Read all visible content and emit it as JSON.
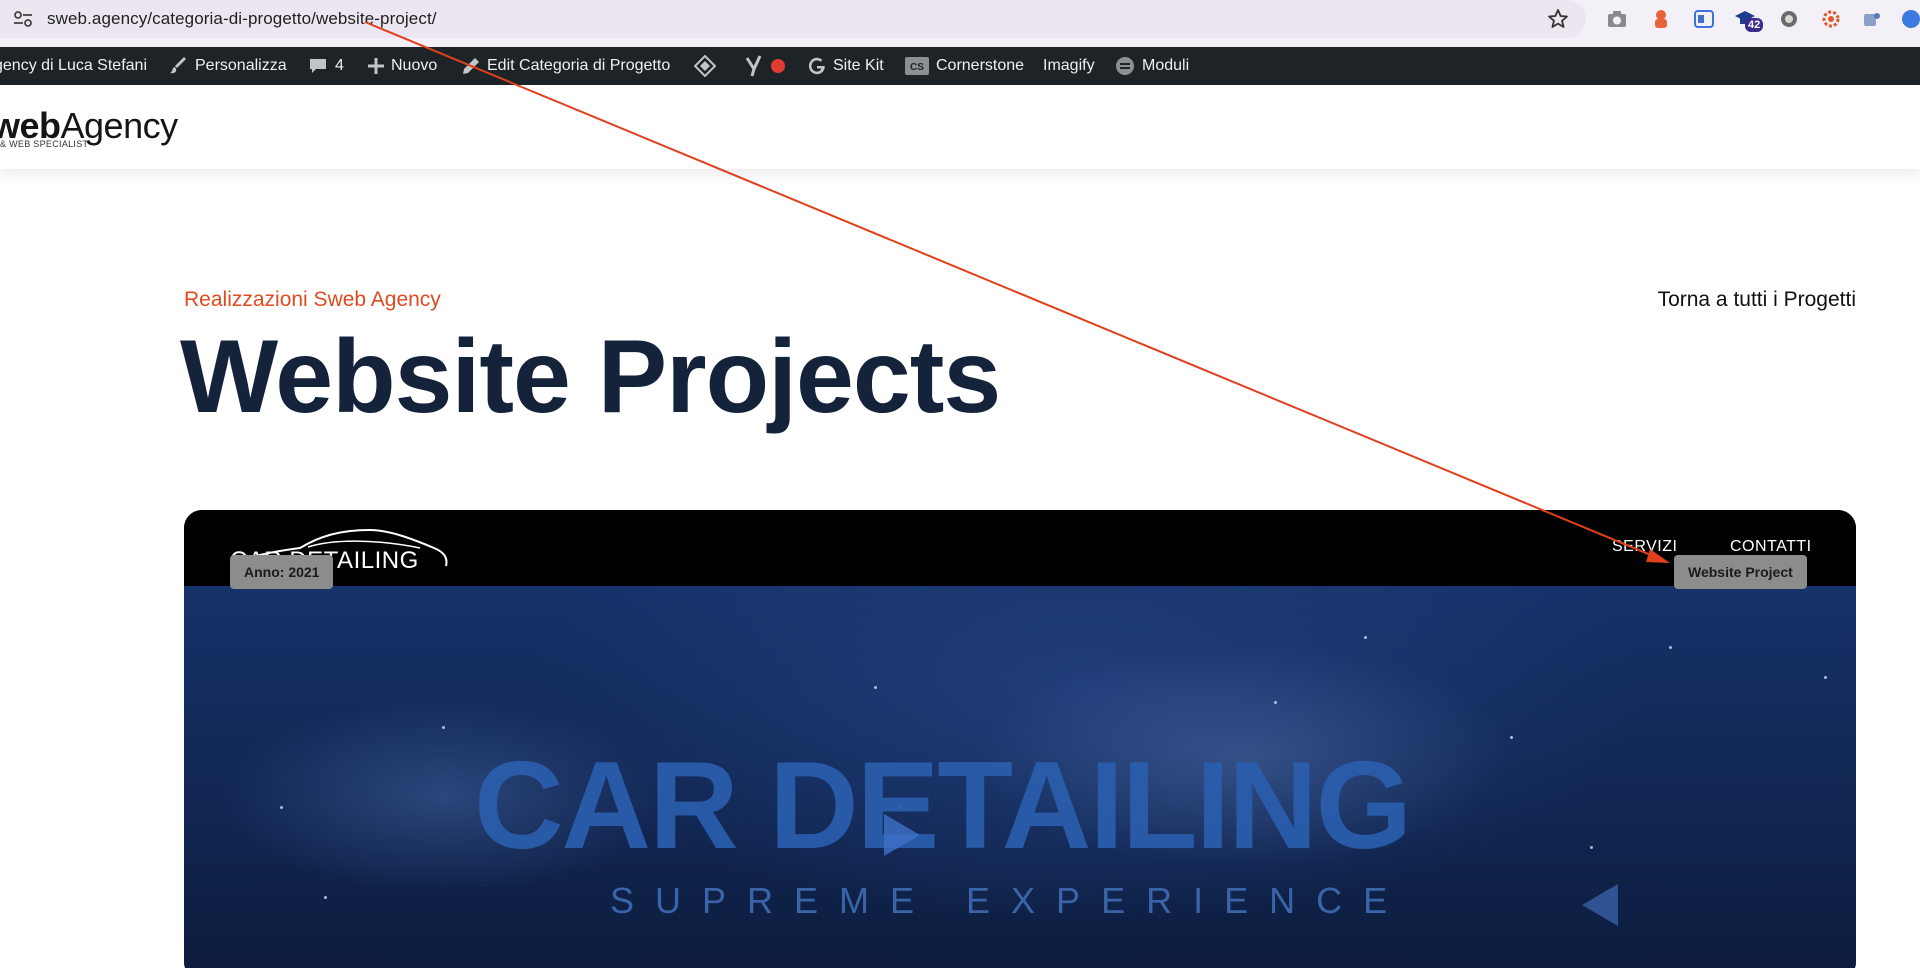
{
  "browser": {
    "url": "sweb.agency/categoria-di-progetto/website-project/",
    "extension_badge": "42",
    "colors": {
      "bar": "#f3f1f7",
      "pill": "#ece6f1"
    }
  },
  "admin_bar": {
    "items": [
      {
        "label": "gency di Luca Stefani",
        "icon": ""
      },
      {
        "label": "Personalizza",
        "icon": "brush-icon"
      },
      {
        "label": "4",
        "icon": "comment-icon"
      },
      {
        "label": "Nuovo",
        "icon": "plus-icon"
      },
      {
        "label": "Edit Categoria di Progetto",
        "icon": "pencil-icon"
      },
      {
        "label": "",
        "icon": "diamond-icon"
      },
      {
        "label": "",
        "icon": "yoast-icon"
      },
      {
        "label": "Site Kit",
        "icon": "google-icon"
      },
      {
        "label": "Cornerstone",
        "icon": "cs-icon"
      },
      {
        "label": "Imagify",
        "icon": ""
      },
      {
        "label": "Moduli",
        "icon": "forms-icon"
      }
    ],
    "colors": {
      "background": "#1d2327",
      "text": "#f0f0f1"
    }
  },
  "site": {
    "logo_strong": "web",
    "logo_light": "Agency",
    "logo_tagline": "& WEB SPECIALIST"
  },
  "hero": {
    "eyebrow": "Realizzazioni Sweb Agency",
    "back_link": "Torna a tutti i Progetti",
    "title": "Website Projects",
    "colors": {
      "eyebrow": "#e04a1f",
      "title": "#14233a"
    }
  },
  "project_card": {
    "mini_logo_text": "CAR DETAILING",
    "mini_nav": [
      "SERVIZI",
      "CONTATTI"
    ],
    "year_tag": "Anno: 2021",
    "category_tag": "Website Project",
    "headline": "CAR DETAILING",
    "subheadline": "SUPREME EXPERIENCE"
  },
  "annotation": {
    "color": "#e0401c",
    "shape": "arrow"
  }
}
